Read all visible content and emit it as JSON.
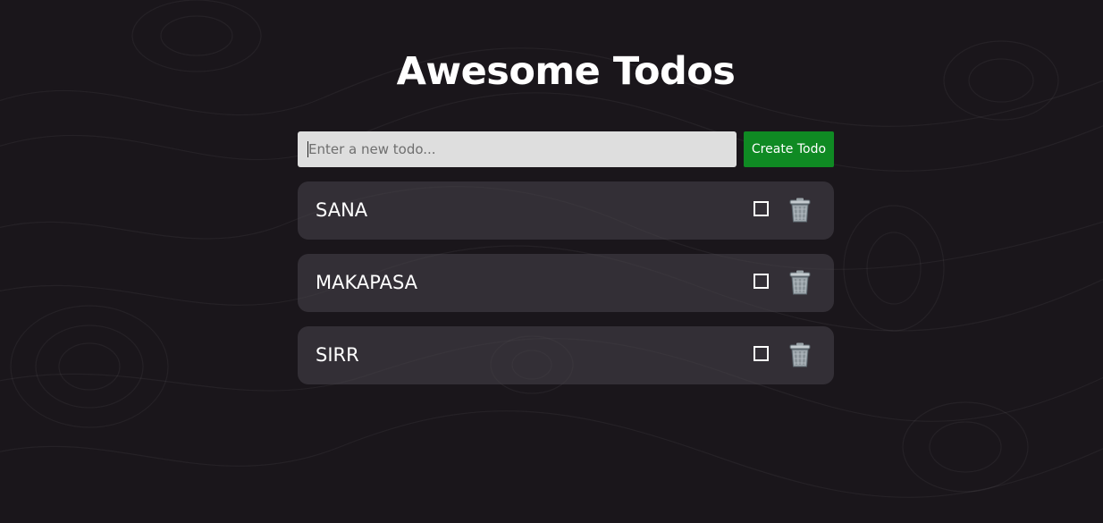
{
  "header": {
    "title": "Awesome Todos"
  },
  "form": {
    "placeholder": "Enter a new todo...",
    "input_value": "",
    "button_label": "Create Todo"
  },
  "todos": [
    {
      "text": "SANA",
      "done": false
    },
    {
      "text": "MAKAPASA",
      "done": false
    },
    {
      "text": "SIRR",
      "done": false
    }
  ],
  "icons": {
    "delete": "trash-icon",
    "checkbox": "checkbox-icon"
  },
  "colors": {
    "background": "#1a161b",
    "card": "#2f2c32",
    "input_background": "#dedede",
    "button": "#0f8a23",
    "text": "#ffffff"
  }
}
